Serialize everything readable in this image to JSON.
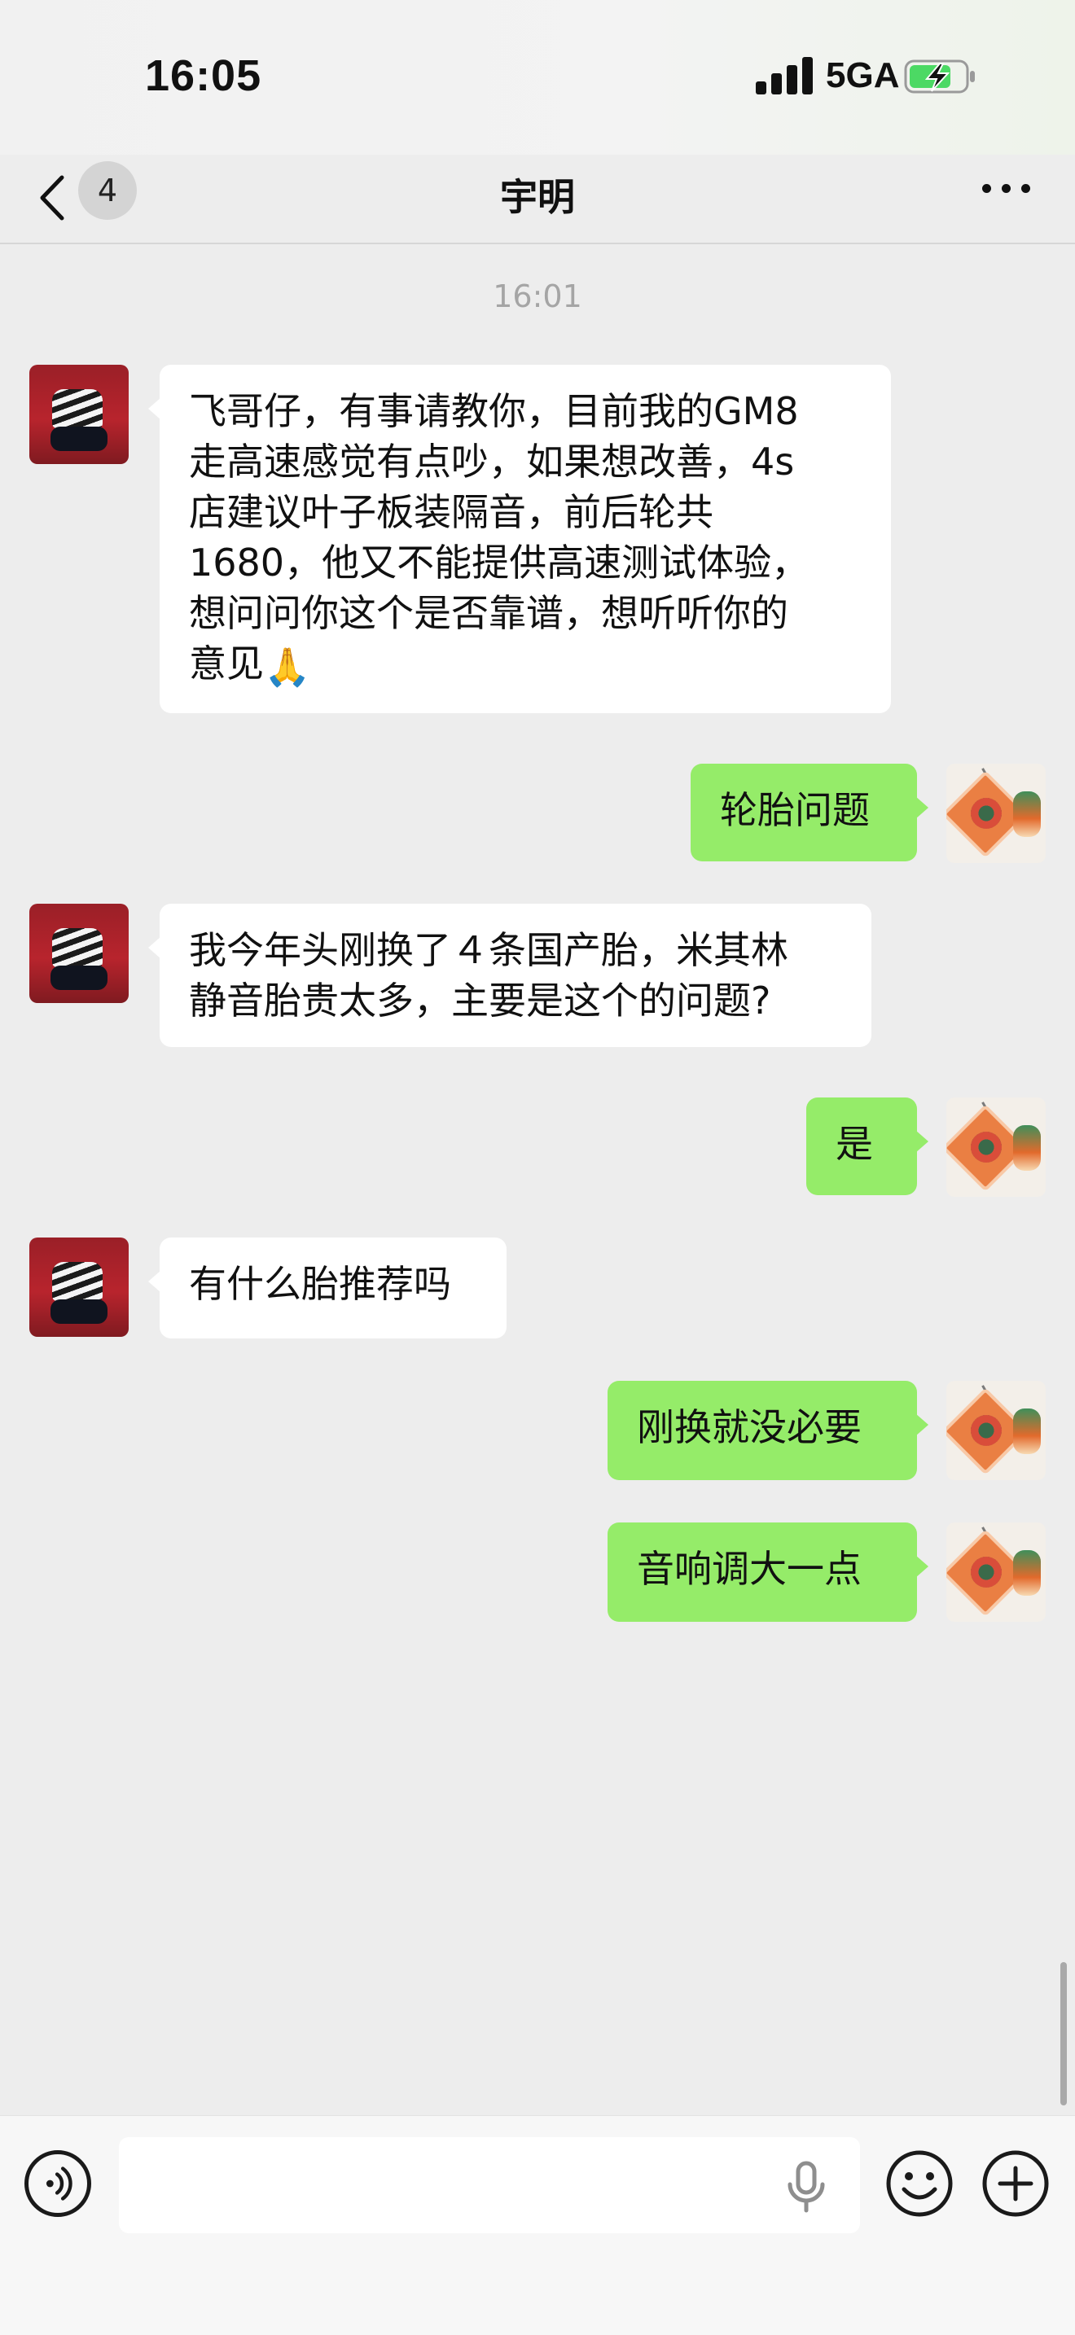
{
  "status_bar": {
    "time": "16:05",
    "network": "5GA"
  },
  "nav": {
    "unread_count": "4",
    "title": "宇明"
  },
  "chat": {
    "timestamp": "16:01",
    "messages": [
      {
        "sender": "friend",
        "text": "飞哥仔，有事请教你，目前我的GM8\n走高速感觉有点吵，如果想改善，4s\n店建议叶子板装隔音，前后轮共\n1680，他又不能提供高速测试体验，\n想问问你这个是否靠谱，想听听你的\n意见",
        "emoji": "🙏"
      },
      {
        "sender": "self",
        "text": "轮胎问题"
      },
      {
        "sender": "friend",
        "text": "我今年头刚换了４条国产胎，米其林\n静音胎贵太多，主要是这个的问题?"
      },
      {
        "sender": "self",
        "text": "是"
      },
      {
        "sender": "friend",
        "text": "有什么胎推荐吗"
      },
      {
        "sender": "self",
        "text": "刚换就没必要"
      },
      {
        "sender": "self",
        "text": "音响调大一点"
      }
    ]
  },
  "input_bar": {
    "placeholder": ""
  },
  "colors": {
    "background": "#ededed",
    "bubble_out": "#95ec69",
    "bubble_in": "#ffffff",
    "battery_charge": "#4cd964"
  }
}
